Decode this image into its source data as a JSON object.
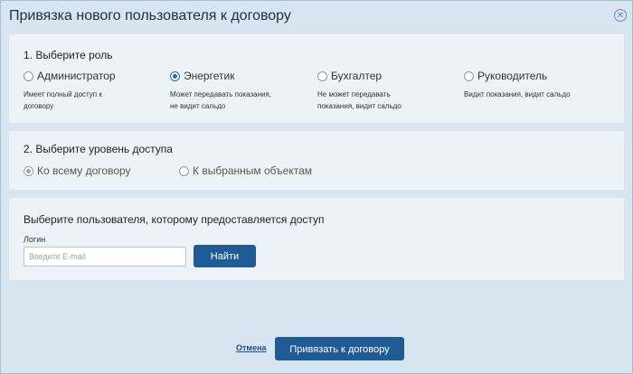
{
  "dialog": {
    "title": "Привязка нового пользователя к договору",
    "close_glyph": "✕"
  },
  "role_section": {
    "title": "1. Выберите роль",
    "selected": "Энергетик",
    "options": [
      {
        "label": "Администратор",
        "desc_line1": "Имеет полный доступ к",
        "desc_line2": "договору"
      },
      {
        "label": "Энергетик",
        "desc_line1": "Может передавать показания,",
        "desc_line2": "не видит сальдо"
      },
      {
        "label": "Бухгалтер",
        "desc_line1": "Не может передавать",
        "desc_line2": "показания, видит сальдо"
      },
      {
        "label": "Руководитель",
        "desc_line1": "Видит показания, видит сальдо",
        "desc_line2": ""
      }
    ]
  },
  "access_section": {
    "title": "2. Выберите уровень доступа",
    "selected": "Ко всему договору",
    "options": [
      {
        "label": "Ко всему договору"
      },
      {
        "label": "К выбранным объектам"
      }
    ]
  },
  "user_section": {
    "title": "Выберите пользователя, которому предоставляется доступ",
    "login_label": "Логин",
    "email_placeholder": "Введите E-mail",
    "email_value": "",
    "find_button": "Найти"
  },
  "footer": {
    "cancel_link": "Отмена",
    "submit_button": "Привязать к договору"
  },
  "colors": {
    "primary_button": "#1f5b94",
    "selected_radio": "#2a6cb0",
    "panel_bg": "#edf2f8",
    "dialog_bg": "#d7e5f0"
  }
}
